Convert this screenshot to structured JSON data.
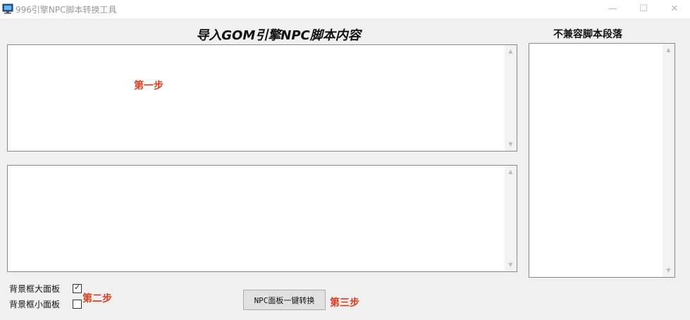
{
  "window": {
    "title": "996引擎NPC脚本转换工具",
    "min_glyph": "—",
    "max_glyph": "☐",
    "close_glyph": "✕"
  },
  "main_heading": "导入GOM引擎NPC脚本内容",
  "side_heading": "不兼容脚本段落",
  "steps": {
    "step1": "第一步",
    "step2": "第二步",
    "step3": "第三步"
  },
  "options": [
    {
      "label": "背景框大面板",
      "checked": true
    },
    {
      "label": "背景框小面板",
      "checked": false
    }
  ],
  "convert_button": "NPC面板一键转换",
  "textareas": {
    "import_content": "",
    "output_content": "",
    "incompatible_content": ""
  },
  "colors": {
    "accent_red": "#e03c1a",
    "window_bg": "#f0f0f0"
  },
  "icons": {
    "app": "monitor-icon",
    "scroll_up": "scroll-up-arrow",
    "scroll_down": "scroll-down-arrow"
  }
}
